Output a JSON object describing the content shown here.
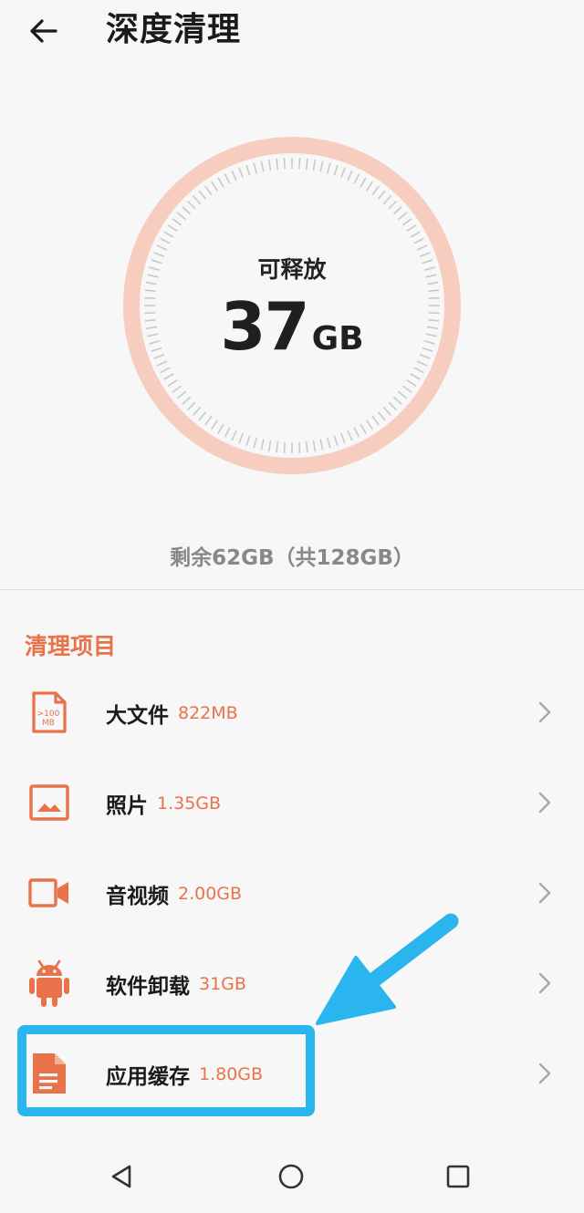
{
  "header": {
    "title": "深度清理",
    "back_icon": "arrow-left-icon"
  },
  "gauge": {
    "label": "可释放",
    "value": "37",
    "unit": "GB",
    "ring_color": "#f7cdbf"
  },
  "storage": {
    "summary": "剩余62GB（共128GB）"
  },
  "section": {
    "title": "清理项目"
  },
  "items": [
    {
      "name": "大文件",
      "size": "822MB",
      "icon": "large-file-icon",
      "icon_text_1": ">100",
      "icon_text_2": "MB"
    },
    {
      "name": "照片",
      "size": "1.35GB",
      "icon": "photo-icon"
    },
    {
      "name": "音视频",
      "size": "2.00GB",
      "icon": "video-icon"
    },
    {
      "name": "软件卸载",
      "size": "31GB",
      "icon": "android-icon"
    },
    {
      "name": "应用缓存",
      "size": "1.80GB",
      "icon": "document-icon"
    }
  ],
  "colors": {
    "accent": "#e8734a",
    "highlight": "#2bb5ee",
    "text": "#1a1a1a",
    "secondary": "#888888"
  },
  "navbar": {
    "back_icon": "triangle-back-icon",
    "home_icon": "circle-home-icon",
    "recents_icon": "square-recents-icon"
  }
}
